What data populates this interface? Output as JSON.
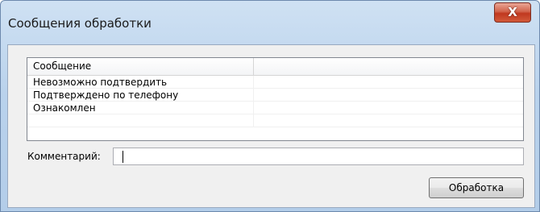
{
  "window": {
    "title": "Сообщения обработки",
    "close_glyph": "X"
  },
  "list": {
    "header": "Сообщение",
    "rows": [
      "Невозможно подтвердить",
      "Подтверждено по телефону",
      "Ознакомлен"
    ]
  },
  "comment": {
    "label": "Комментарий:",
    "value": ""
  },
  "buttons": {
    "process": "Обработка"
  }
}
